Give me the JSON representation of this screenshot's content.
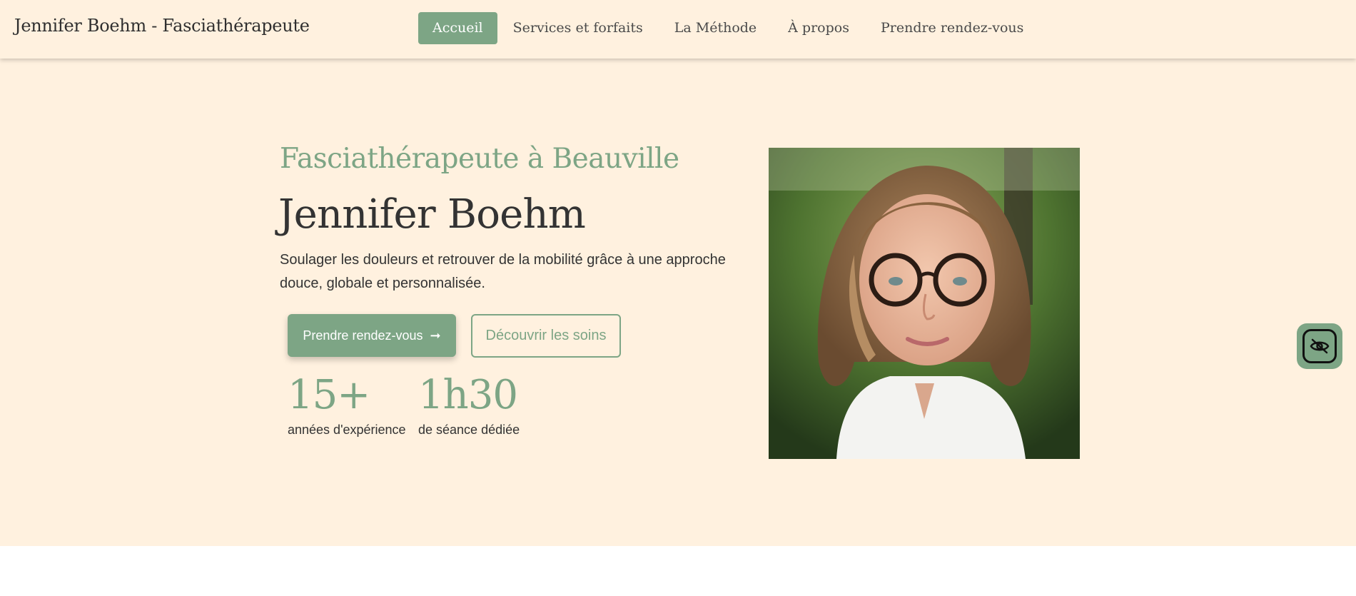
{
  "header": {
    "brand": "Jennifer Boehm - Fasciathérapeute",
    "nav": [
      {
        "label": "Accueil",
        "active": true
      },
      {
        "label": "Services et forfaits",
        "active": false
      },
      {
        "label": "La Méthode",
        "active": false
      },
      {
        "label": "À propos",
        "active": false
      },
      {
        "label": "Prendre rendez-vous",
        "active": false
      }
    ]
  },
  "hero": {
    "subtitle": "Fasciathérapeute à Beauville",
    "title": "Jennifer Boehm",
    "description": "Soulager les douleurs et retrouver de la mobilité grâce à une approche douce, globale et personnalisée.",
    "primary_button": "Prendre rendez-vous",
    "primary_button_icon": "arrow-right-icon",
    "secondary_button": "Découvrir les soins",
    "stats": [
      {
        "value": "15+",
        "label": "années d'expérience"
      },
      {
        "value": "1h30",
        "label": "de séance dédiée"
      }
    ],
    "portrait_icon": "portrait-photo"
  },
  "accessibility": {
    "icon": "eye-off-icon"
  },
  "colors": {
    "accent": "#7da585",
    "background": "#fff1df",
    "text": "#333333"
  }
}
